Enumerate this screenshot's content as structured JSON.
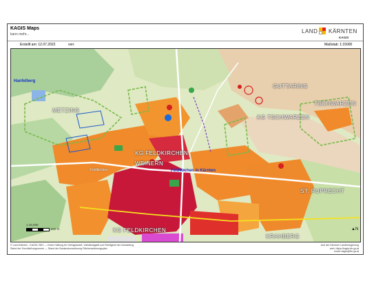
{
  "header": {
    "title": "KAGIS Maps",
    "subtitle": "kann mehr...",
    "logo_land": "LAND",
    "logo_kaernten": "KÄRNTEN",
    "logo_kagis": "KAGIS"
  },
  "meta": {
    "created": "Erstellt am: 12.07.2022",
    "from": "von:",
    "scale": "Maßstab: 1:15000"
  },
  "map": {
    "labels": {
      "hanfelberg": "Hanfelberg",
      "guttaring": "GUTTARING",
      "metzing": "METZING",
      "tschwarzen": "TSCHWARZEN",
      "kg_tschwarzen": "KG TSCHWARZEN",
      "kg_feldkirchen_n": "KG FELDKIRCHEN",
      "weinern": "WEINERN",
      "feldkirchen_town": "Feldkirchen",
      "feldkirchen_in_kaernten": "Feldkirchen in Kärnten",
      "st_ruprecht": "ST. RUPRECHT",
      "kg_feldkirchen_s": "KG FELDKIRCHEN",
      "krahberg": "KRAHBERG"
    },
    "scalebar_text": "500 m",
    "scale_small": "1:15,000",
    "north": "N",
    "colors": {
      "residential": "#f08a2b",
      "core": "#c8183a",
      "industrial": "#e0302c",
      "green": "#8fc26a",
      "forest": "#9bc8a0",
      "agri": "#d9e8b8",
      "fields": "#e5c9a8",
      "boundary": "#79b84b"
    }
  },
  "footer": {
    "left_line1": "© Land Kärnten - KAGIS, BEV — Keine Haftung für Verfügbarkeit, Vollständigkeit und Richtigkeit der Darstellung",
    "left_line2": "Stand der Erschließungszonen — Stand der Baulandumwidmung Flächenwidmungsplan",
    "right_line1": "Amt der Kärntner Landesregierung",
    "right_line2": "web: https://kagis.ktn.gv.at",
    "right_line3": "email: kagis@ktn.gv.at"
  }
}
